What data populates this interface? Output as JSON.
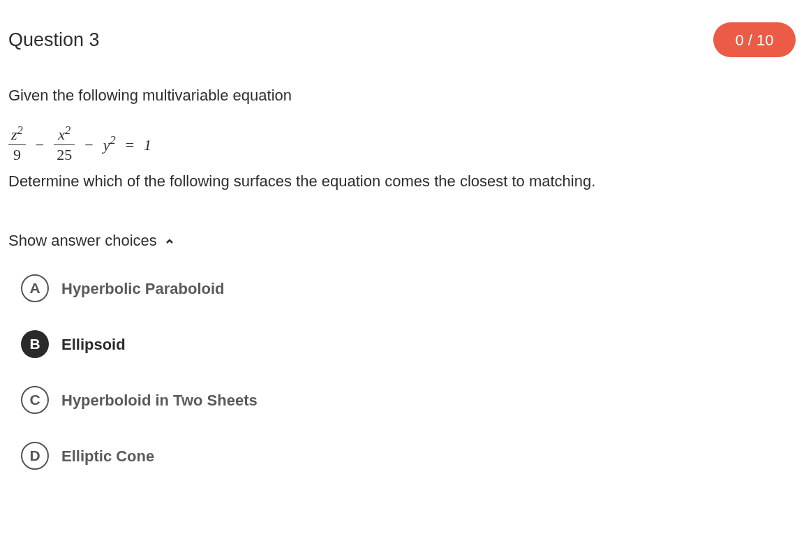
{
  "question": {
    "title": "Question 3",
    "score": "0 / 10"
  },
  "prompt": "Given the following multivariable equation",
  "equation": [
    {
      "kind": "fraction",
      "numerator": "z$^{2}$",
      "denominator": "9"
    },
    {
      "kind": "operator",
      "text": "−"
    },
    {
      "kind": "fraction",
      "numerator": "x$^{2}$",
      "denominator": "25"
    },
    {
      "kind": "operator",
      "text": "−"
    },
    {
      "kind": "term",
      "text": "y$^{2}$"
    },
    {
      "kind": "operator",
      "text": "="
    },
    {
      "kind": "term",
      "text": "1"
    }
  ],
  "instruction": "Determine which of the following surfaces the equation comes the closest to matching.",
  "toggle": {
    "label": "Show answer choices",
    "expanded": true
  },
  "choices": [
    {
      "letter": "A",
      "label": "Hyperbolic Paraboloid",
      "selected": false
    },
    {
      "letter": "B",
      "label": "Ellipsoid",
      "selected": true
    },
    {
      "letter": "C",
      "label": "Hyperboloid in Two Sheets",
      "selected": false
    },
    {
      "letter": "D",
      "label": "Elliptic Cone",
      "selected": false
    }
  ]
}
